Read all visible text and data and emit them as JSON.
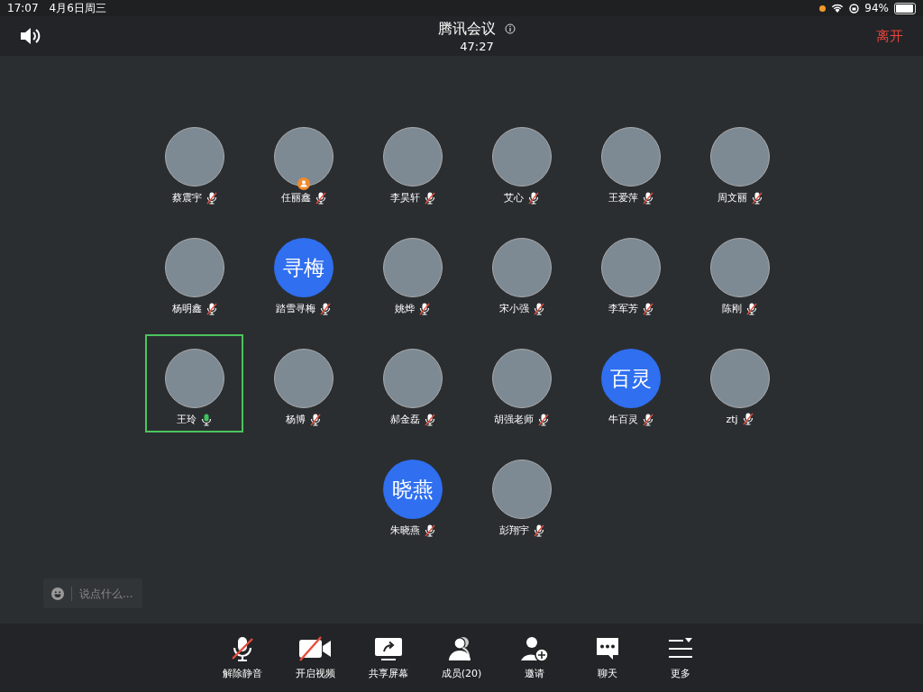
{
  "status_bar": {
    "time": "17:07",
    "date": "4月6日周三",
    "battery": "94%",
    "level": 0.94
  },
  "header": {
    "title": "腾讯会议",
    "timer": "47:27",
    "leave": "离开"
  },
  "participants": [
    {
      "name": "蔡震宇",
      "kind": "photo",
      "muted": true,
      "selected": false,
      "host": false
    },
    {
      "name": "任丽鑫",
      "kind": "photo",
      "muted": true,
      "selected": false,
      "host": true
    },
    {
      "name": "李昊轩",
      "kind": "photo",
      "muted": true,
      "selected": false,
      "host": false
    },
    {
      "name": "艾心",
      "kind": "photo",
      "muted": true,
      "selected": false,
      "host": false
    },
    {
      "name": "王爱萍",
      "kind": "photo",
      "muted": true,
      "selected": false,
      "host": false
    },
    {
      "name": "周文丽",
      "kind": "photo",
      "muted": true,
      "selected": false,
      "host": false
    },
    {
      "name": "杨明鑫",
      "kind": "photo",
      "muted": true,
      "selected": false,
      "host": false
    },
    {
      "name": "踏雪寻梅",
      "kind": "text",
      "avatar_text": "寻梅",
      "muted": true,
      "selected": false,
      "host": false
    },
    {
      "name": "姚烨",
      "kind": "photo",
      "muted": true,
      "selected": false,
      "host": false
    },
    {
      "name": "宋小强",
      "kind": "photo",
      "muted": true,
      "selected": false,
      "host": false
    },
    {
      "name": "李军芳",
      "kind": "photo",
      "muted": true,
      "selected": false,
      "host": false
    },
    {
      "name": "陈刚",
      "kind": "photo",
      "muted": true,
      "selected": false,
      "host": false
    },
    {
      "name": "王玲",
      "kind": "photo",
      "muted": false,
      "selected": true,
      "host": false
    },
    {
      "name": "杨博",
      "kind": "photo",
      "muted": true,
      "selected": false,
      "host": false
    },
    {
      "name": "郝金磊",
      "kind": "photo",
      "muted": true,
      "selected": false,
      "host": false
    },
    {
      "name": "胡强老师",
      "kind": "photo",
      "muted": true,
      "selected": false,
      "host": false
    },
    {
      "name": "牛百灵",
      "kind": "text",
      "avatar_text": "百灵",
      "muted": true,
      "selected": false,
      "host": false
    },
    {
      "name": "ztj",
      "kind": "photo",
      "muted": true,
      "selected": false,
      "host": false
    },
    {
      "name": "朱晓燕",
      "kind": "text",
      "avatar_text": "晓燕",
      "muted": true,
      "selected": false,
      "host": false
    },
    {
      "name": "彭翔宇",
      "kind": "photo",
      "muted": true,
      "selected": false,
      "host": false
    }
  ],
  "chat_input": {
    "placeholder": "说点什么..."
  },
  "toolbar": [
    {
      "kind": "mic",
      "label": "解除静音"
    },
    {
      "kind": "video",
      "label": "开启视频"
    },
    {
      "kind": "share",
      "label": "共享屏幕"
    },
    {
      "kind": "members",
      "label": "成员(20)"
    },
    {
      "kind": "invite",
      "label": "邀请"
    },
    {
      "kind": "chat",
      "label": "聊天"
    },
    {
      "kind": "more",
      "label": "更多"
    }
  ]
}
